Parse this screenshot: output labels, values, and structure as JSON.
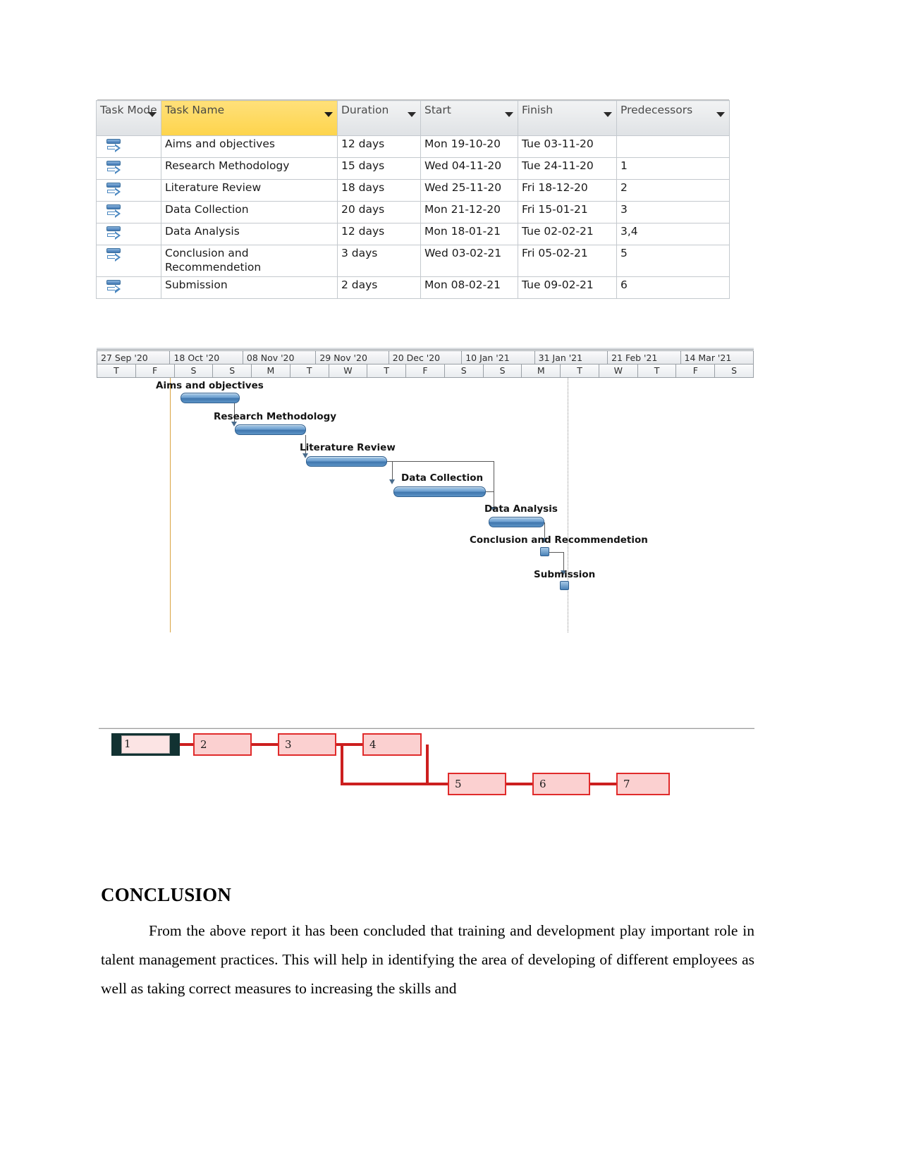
{
  "task_table": {
    "columns": [
      {
        "key": "mode",
        "label": "Task Mode"
      },
      {
        "key": "name",
        "label": "Task Name"
      },
      {
        "key": "duration",
        "label": "Duration"
      },
      {
        "key": "start",
        "label": "Start"
      },
      {
        "key": "finish",
        "label": "Finish"
      },
      {
        "key": "predecessors",
        "label": "Predecessors"
      }
    ],
    "mode_icon": "auto-schedule-icon",
    "filter_icon": "chevron-down-icon",
    "rows": [
      {
        "name": "Aims and objectives",
        "duration": "12 days",
        "start": "Mon 19-10-20",
        "finish": "Tue 03-11-20",
        "predecessors": ""
      },
      {
        "name": "Research Methodology",
        "duration": "15 days",
        "start": "Wed 04-11-20",
        "finish": "Tue 24-11-20",
        "predecessors": "1"
      },
      {
        "name": "Literature Review",
        "duration": "18 days",
        "start": "Wed 25-11-20",
        "finish": "Fri 18-12-20",
        "predecessors": "2"
      },
      {
        "name": "Data Collection",
        "duration": "20 days",
        "start": "Mon 21-12-20",
        "finish": "Fri 15-01-21",
        "predecessors": "3"
      },
      {
        "name": "Data Analysis",
        "duration": "12 days",
        "start": "Mon 18-01-21",
        "finish": "Tue 02-02-21",
        "predecessors": "3,4"
      },
      {
        "name": "Conclusion and Recommendetion",
        "duration": "3 days",
        "start": "Wed 03-02-21",
        "finish": "Fri 05-02-21",
        "predecessors": "5"
      },
      {
        "name": "Submission",
        "duration": "2 days",
        "start": "Mon 08-02-21",
        "finish": "Tue 09-02-21",
        "predecessors": "6"
      }
    ]
  },
  "gantt": {
    "timeline_months": [
      "27 Sep '20",
      "18 Oct '20",
      "08 Nov '20",
      "29 Nov '20",
      "20 Dec '20",
      "10 Jan '21",
      "31 Jan '21",
      "21 Feb '21",
      "14 Mar '21"
    ],
    "timeline_days": [
      "T",
      "F",
      "S",
      "S",
      "M",
      "T",
      "W",
      "T",
      "F",
      "S",
      "S",
      "M",
      "T",
      "W",
      "T",
      "F",
      "S"
    ],
    "bars": [
      {
        "label": "Aims and objectives",
        "type": "bar"
      },
      {
        "label": "Research Methodology",
        "type": "bar"
      },
      {
        "label": "Literature Review",
        "type": "bar"
      },
      {
        "label": "Data Collection",
        "type": "bar"
      },
      {
        "label": "Data Analysis",
        "type": "bar"
      },
      {
        "label": "Conclusion and Recommendetion",
        "type": "milestone"
      },
      {
        "label": "Submission",
        "type": "milestone"
      }
    ],
    "bar_color": "#4a82b8",
    "project_line_color": "#d9a441",
    "today_line_color": "#8a8a8a"
  },
  "network": {
    "accent_color": "#cc1f1f",
    "node_fill": "#fbd0d0",
    "nodes": [
      {
        "id": "1",
        "selected": true
      },
      {
        "id": "2",
        "selected": false
      },
      {
        "id": "3",
        "selected": false
      },
      {
        "id": "4",
        "selected": false
      },
      {
        "id": "5",
        "selected": false
      },
      {
        "id": "6",
        "selected": false
      },
      {
        "id": "7",
        "selected": false
      }
    ],
    "edges": [
      {
        "from": "1",
        "to": "2"
      },
      {
        "from": "2",
        "to": "3"
      },
      {
        "from": "3",
        "to": "4"
      },
      {
        "from": "3",
        "to": "5"
      },
      {
        "from": "4",
        "to": "5"
      },
      {
        "from": "5",
        "to": "6"
      },
      {
        "from": "6",
        "to": "7"
      }
    ]
  },
  "conclusion": {
    "heading": "CONCLUSION",
    "paragraph": "From the above report it has been concluded that training and development play important role in talent management practices. This will help in identifying the area of developing of different employees as well as taking correct measures to increasing the skills and"
  }
}
